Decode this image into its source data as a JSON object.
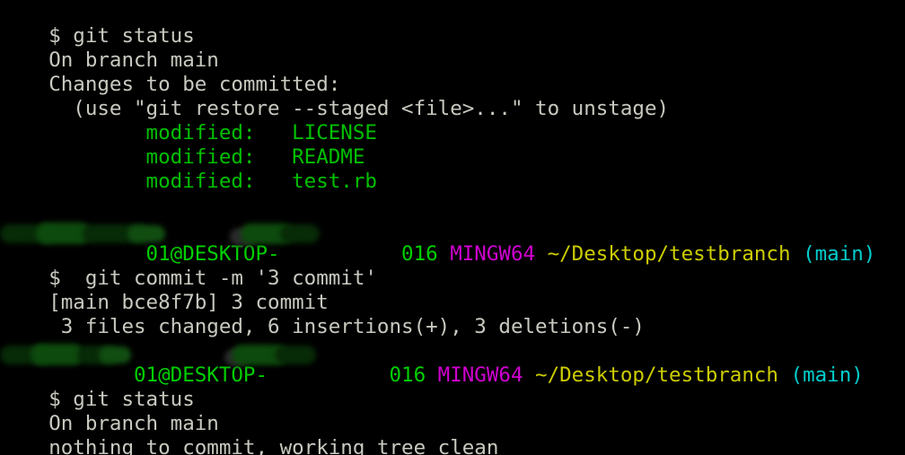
{
  "terminal": {
    "title": "MINGW64 git bash",
    "background_color": "#000000",
    "colors": {
      "default_text": "#c9c9c0",
      "green": "#00c000",
      "bright_green": "#00d000",
      "magenta": "#d000d0",
      "yellow": "#cdcd00",
      "cyan": "#00cdcd",
      "redaction": "#0b3d0b"
    },
    "lines": {
      "clipped_remnant": " ",
      "l01": "$ git status",
      "l02": "On branch main",
      "l03": "Changes to be committed:",
      "l04": "  (use \"git restore --staged <file>...\" to unstage)",
      "l05_label": "        modified:   ",
      "l05_file": "LICENSE",
      "l06_label": "        modified:   ",
      "l06_file": "README",
      "l07_label": "        modified:   ",
      "l07_file": "test.rb",
      "prompt1_user": "        01@DESKTOP-          016",
      "prompt1_shell": "MINGW64",
      "prompt1_path": "~/Desktop/testbranch",
      "prompt1_branch": "(main)",
      "l09": "$  git commit -m '3 commit'",
      "l10": "[main bce8f7b] 3 commit",
      "l11": " 3 files changed, 6 insertions(+), 3 deletions(-)",
      "prompt2_user": "       01@DESKTOP-          016",
      "prompt2_shell": "MINGW64",
      "prompt2_path": "~/Desktop/testbranch",
      "prompt2_branch": "(main)",
      "l13": "$ git status",
      "l14": "On branch main",
      "l15": "nothing to commit, working tree clean"
    }
  }
}
